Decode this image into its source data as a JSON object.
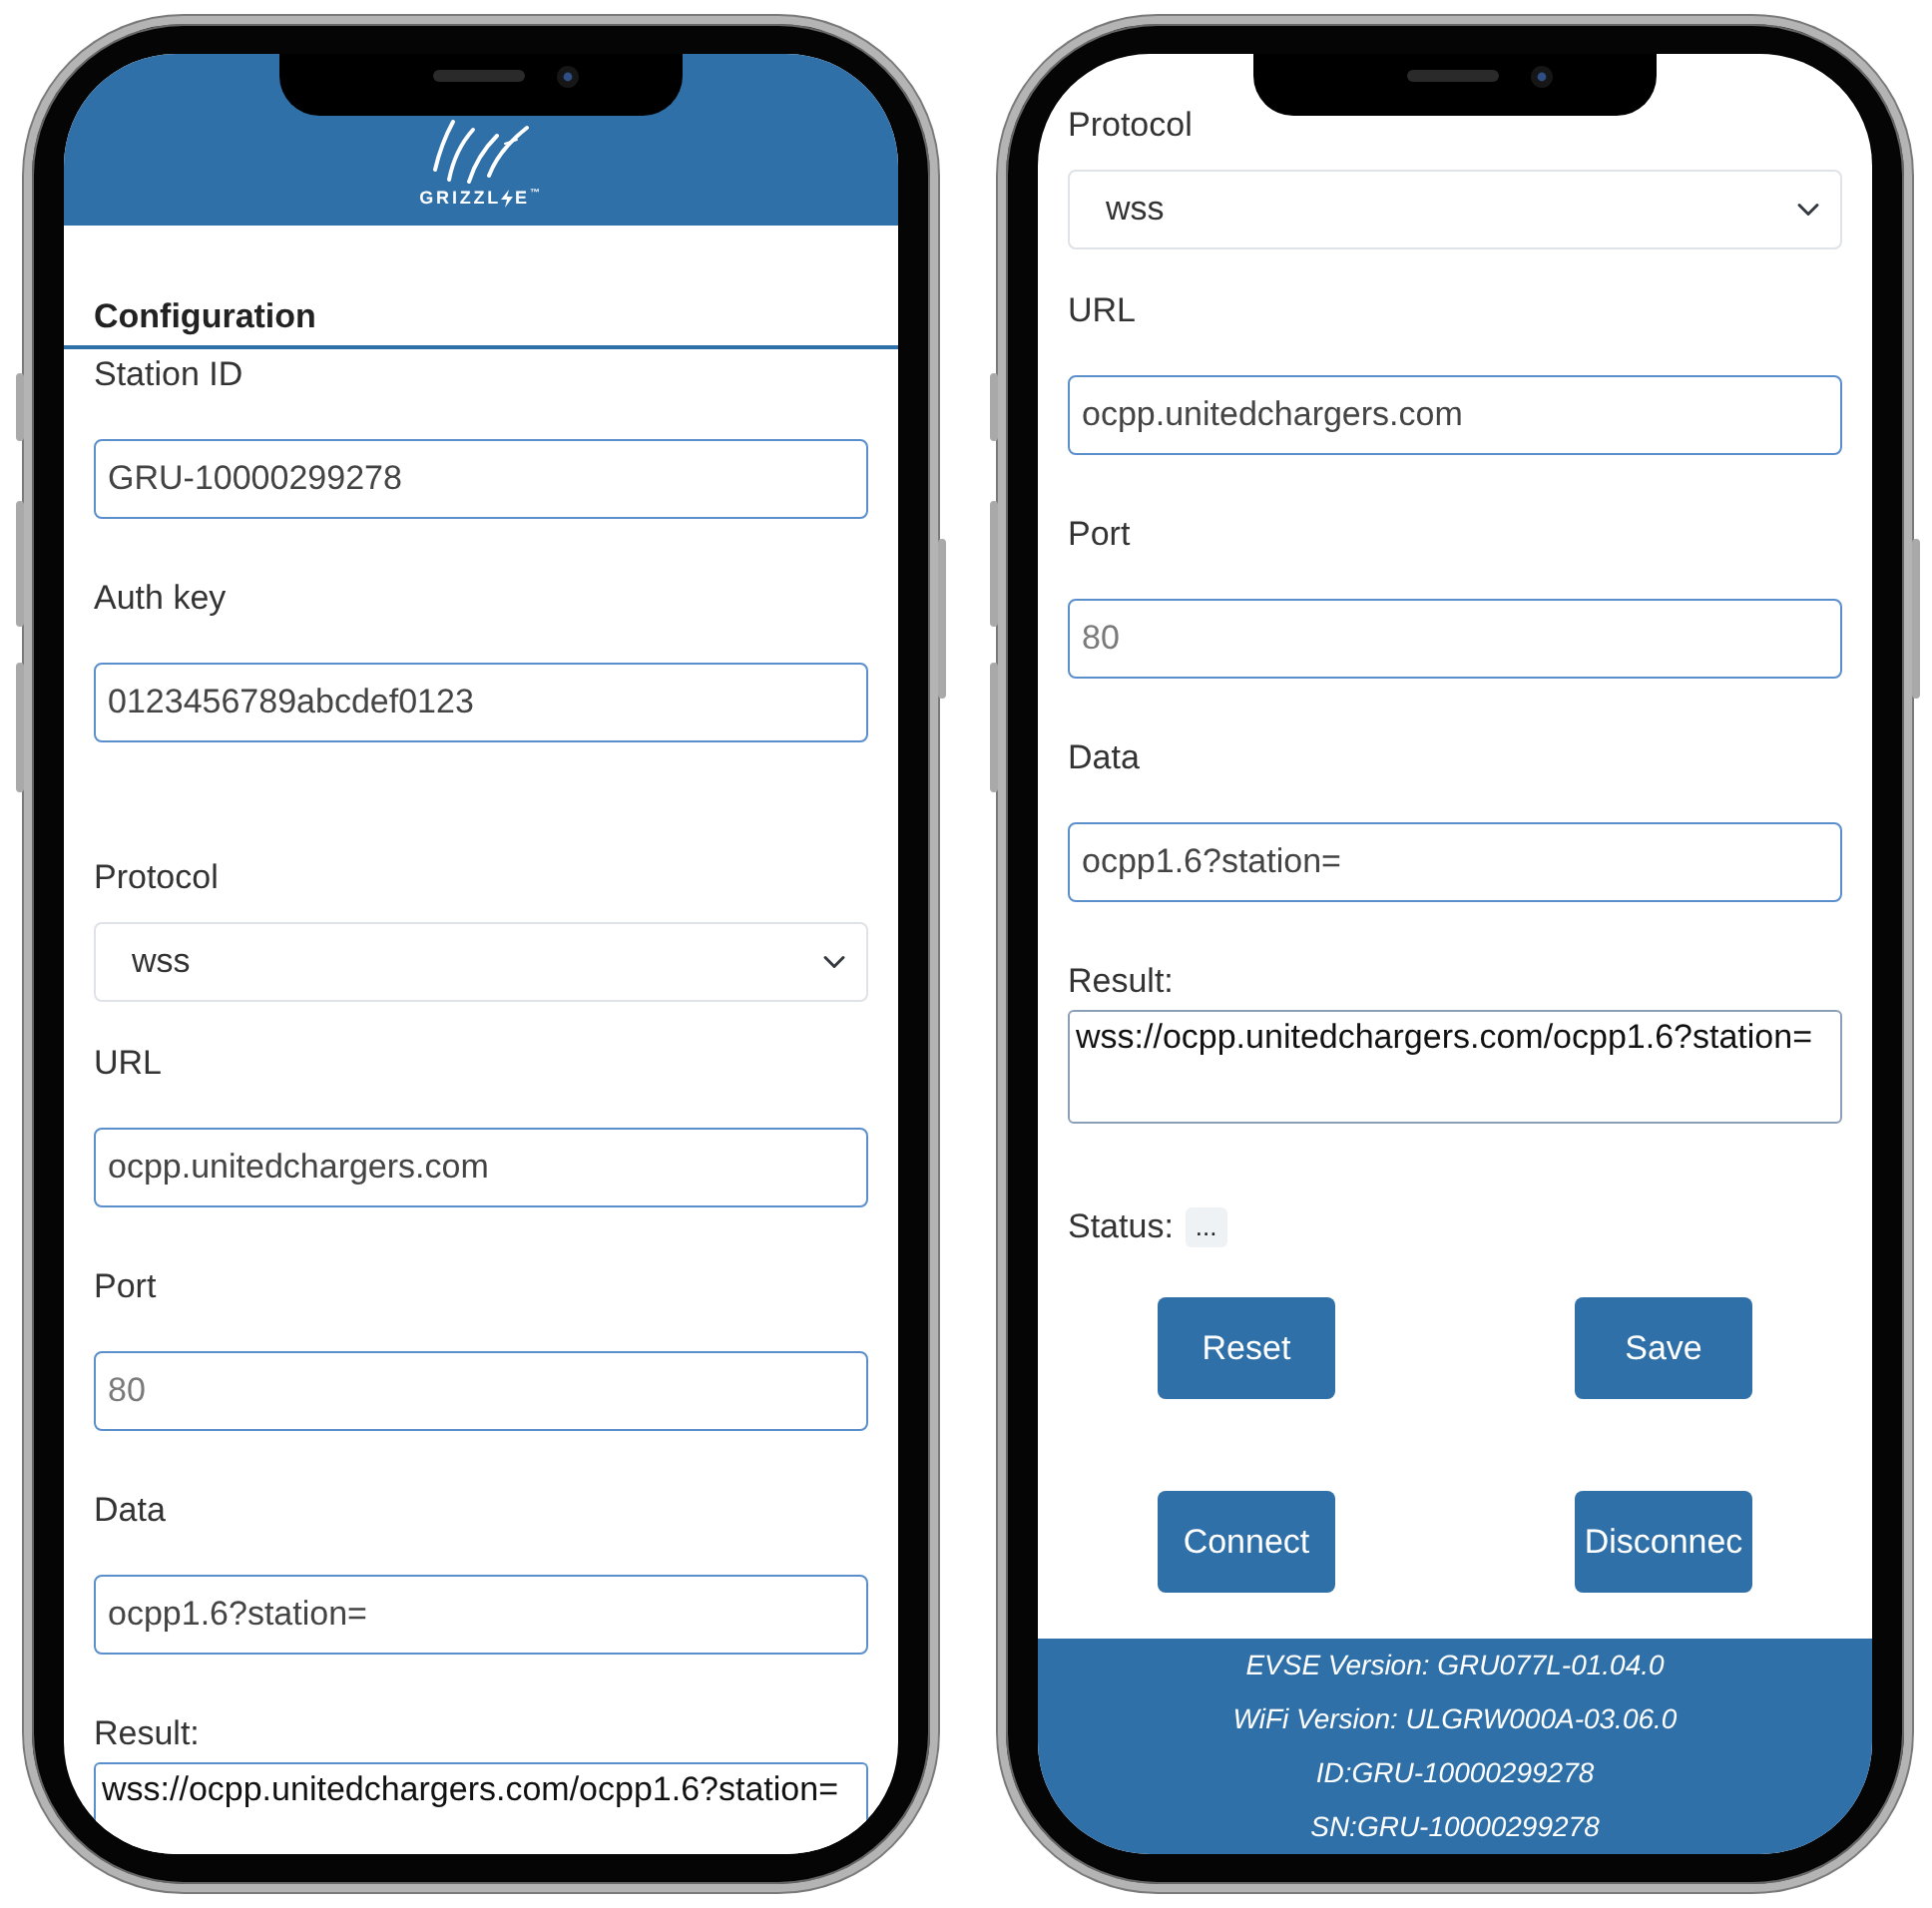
{
  "phones": [
    {
      "kind": "top",
      "header": {
        "logo": {
          "wordmark_start": "GRIZZL",
          "wordmark_end": "E$^{™}$"
        }
      },
      "section_title": "Configuration",
      "fields": [
        {
          "kind": "text",
          "label": "Station ID",
          "value": "GRU-10000299278"
        },
        {
          "kind": "text",
          "label": "Auth key",
          "value": "0123456789abcdef0123"
        },
        {
          "kind": "select",
          "label": "Protocol",
          "value": "wss"
        },
        {
          "kind": "text",
          "label": "URL",
          "value": "ocpp.unitedchargers.com"
        },
        {
          "kind": "text",
          "label": "Port",
          "placeholder": "80"
        },
        {
          "kind": "text",
          "label": "Data",
          "value": "ocpp1.6?station="
        },
        {
          "kind": "textarea",
          "label": "Result:",
          "value": "wss://ocpp.unitedchargers.com/ocpp1.6?station="
        }
      ]
    },
    {
      "kind": "bottom",
      "fields": [
        {
          "kind": "select",
          "label": "Protocol",
          "value": "wss"
        },
        {
          "kind": "text",
          "label": "URL",
          "value": "ocpp.unitedchargers.com"
        },
        {
          "kind": "text",
          "label": "Port",
          "placeholder": "80"
        },
        {
          "kind": "text",
          "label": "Data",
          "value": "ocpp1.6?station="
        },
        {
          "kind": "textarea",
          "label": "Result:",
          "value": "wss://ocpp.unitedchargers.com/ocpp1.6?station="
        }
      ],
      "status": {
        "label": "Status:",
        "value": "..."
      },
      "buttons": [
        "Reset",
        "Save",
        "Connect",
        "Disconnec"
      ],
      "footer": [
        "EVSE Version: GRU077L-01.04.0",
        "WiFi Version: ULGRW000A-03.06.0",
        "ID:GRU-10000299278",
        "SN:GRU-10000299278"
      ]
    }
  ]
}
